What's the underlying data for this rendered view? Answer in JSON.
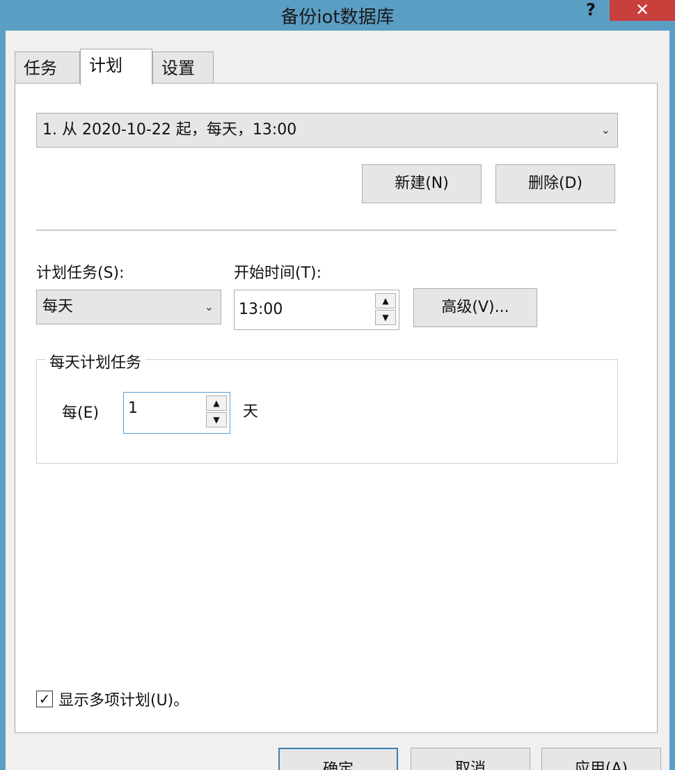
{
  "window": {
    "title": "备份iot数据库",
    "help": "?",
    "close": "✕"
  },
  "tabs": [
    {
      "label": "任务"
    },
    {
      "label": "计划"
    },
    {
      "label": "设置"
    }
  ],
  "schedule": {
    "selected": "1. 从 2020-10-22 起，每天，13:00",
    "new_label": "新建(N)",
    "delete_label": "删除(D)"
  },
  "task": {
    "label": "计划任务(S):",
    "value": "每天",
    "start_label": "开始时间(T):",
    "start_value": "13:00",
    "advanced_label": "高级(V)..."
  },
  "daily": {
    "title": "每天计划任务",
    "every_label": "每(E)",
    "every_value": "1",
    "unit": "天"
  },
  "multi": {
    "checked": true,
    "label": "显示多项计划(U)。"
  },
  "footer": {
    "ok_label": "确定",
    "cancel_label": "取消",
    "apply_label": "应用(A)"
  }
}
